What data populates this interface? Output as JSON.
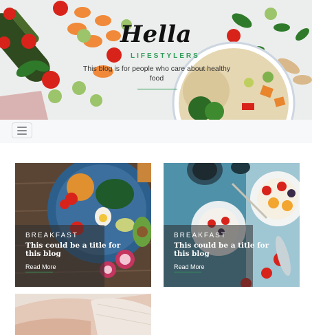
{
  "header": {
    "title": "Hella",
    "subtitle": "LIFESTYLERS",
    "tagline": "This blog is for people who care about healthy food"
  },
  "navbar": {
    "toggle_icon": "hamburger-icon"
  },
  "posts": [
    {
      "category": "BREAKFAST",
      "title": "This could be a title for this blog",
      "link": "Read More"
    },
    {
      "category": "BREAKFAST",
      "title": "This could be a title for this blog",
      "link": "Read More"
    },
    {
      "category": "",
      "title": "",
      "link": ""
    }
  ],
  "colors": {
    "accent": "#2e9b57",
    "overlay": "#2d2d2d",
    "navbar": "#f7f8f9"
  }
}
